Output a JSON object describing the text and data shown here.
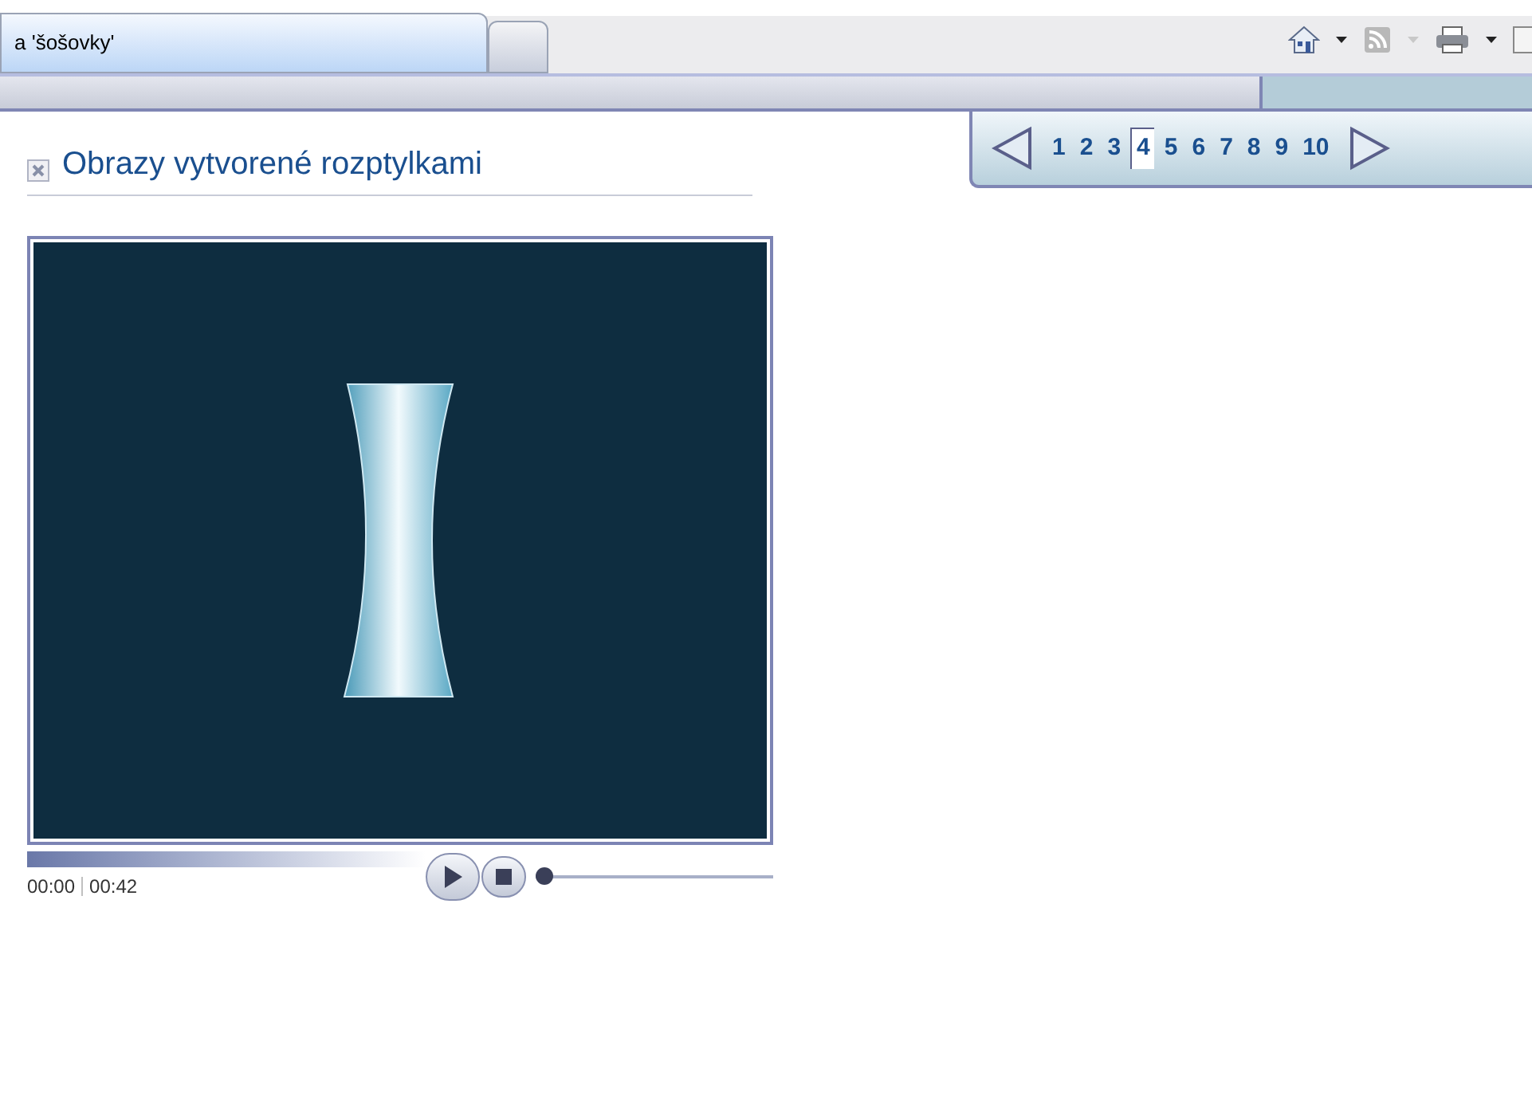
{
  "browser_tab": {
    "title": "a 'šošovky'"
  },
  "article": {
    "title": "Obrazy vytvorené rozptylkami"
  },
  "pagination": {
    "pages": [
      {
        "label": "1",
        "selected": false
      },
      {
        "label": "2",
        "selected": false
      },
      {
        "label": "3",
        "selected": false
      },
      {
        "label": "4",
        "selected": true
      },
      {
        "label": "5",
        "selected": false
      },
      {
        "label": "6",
        "selected": false
      },
      {
        "label": "7",
        "selected": false
      },
      {
        "label": "8",
        "selected": false
      },
      {
        "label": "9",
        "selected": false
      },
      {
        "label": "10",
        "selected": false
      }
    ]
  },
  "player": {
    "elapsed": "00:00",
    "duration": "00:42",
    "volume": {
      "level": 0
    }
  }
}
